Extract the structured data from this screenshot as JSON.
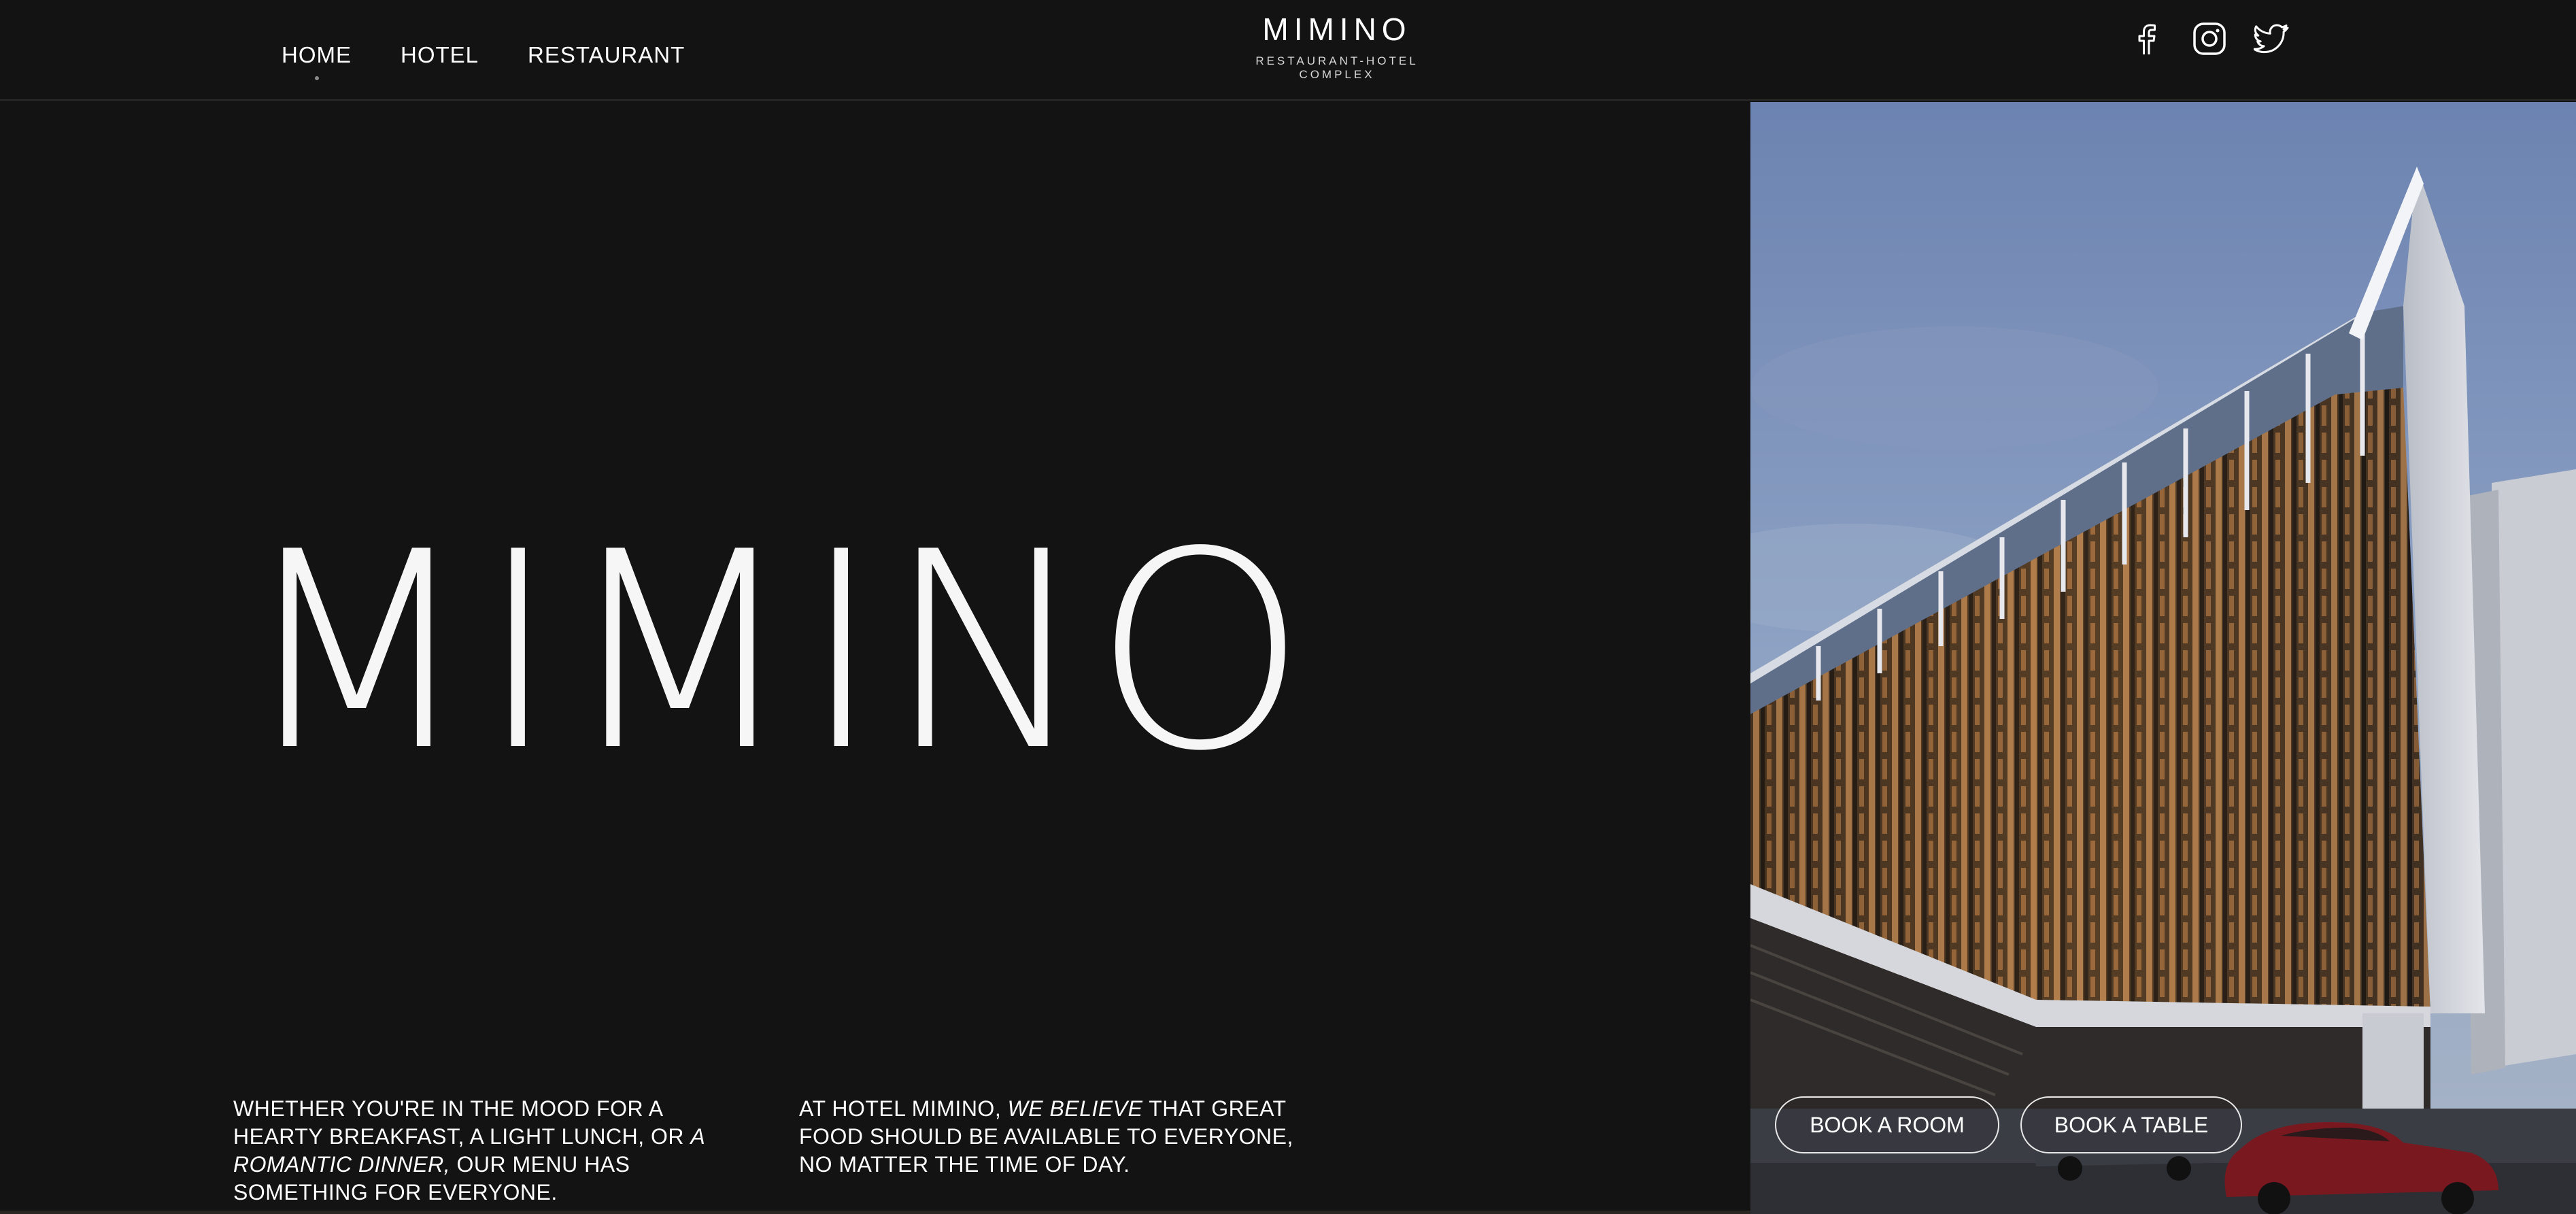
{
  "nav": {
    "items": [
      {
        "label": "HOME",
        "active": true
      },
      {
        "label": "HOTEL",
        "active": false
      },
      {
        "label": "RESTAURANT",
        "active": false
      }
    ]
  },
  "brand": {
    "name": "MIMINO",
    "tagline": "RESTAURANT-HOTEL COMPLEX"
  },
  "social": [
    {
      "icon": "facebook-icon"
    },
    {
      "icon": "instagram-icon"
    },
    {
      "icon": "twitter-icon"
    }
  ],
  "hero": {
    "title": "MIMINO"
  },
  "paragraph_1": {
    "part1": "WHETHER YOU'RE IN THE MOOD FOR A HEARTY BREAKFAST, A LIGHT LUNCH, OR ",
    "emphasis": "A ROMANTIC DINNER,",
    "part2": " OUR MENU HAS SOMETHING FOR EVERYONE."
  },
  "paragraph_2": {
    "part1": "AT HOTEL MIMINO, ",
    "emphasis": "WE BELIEVE",
    "part2": " THAT GREAT FOOD SHOULD BE AVAILABLE TO EVERYONE, NO MATTER THE TIME OF DAY."
  },
  "booking": {
    "room_label": "BOOK A ROOM",
    "table_label": "BOOK A TABLE"
  },
  "colors": {
    "background": "#131313",
    "text": "#ffffff",
    "sky_top": "#6f86b3",
    "sky_bottom": "#9fb1cc",
    "facade_light": "#d9a368"
  }
}
